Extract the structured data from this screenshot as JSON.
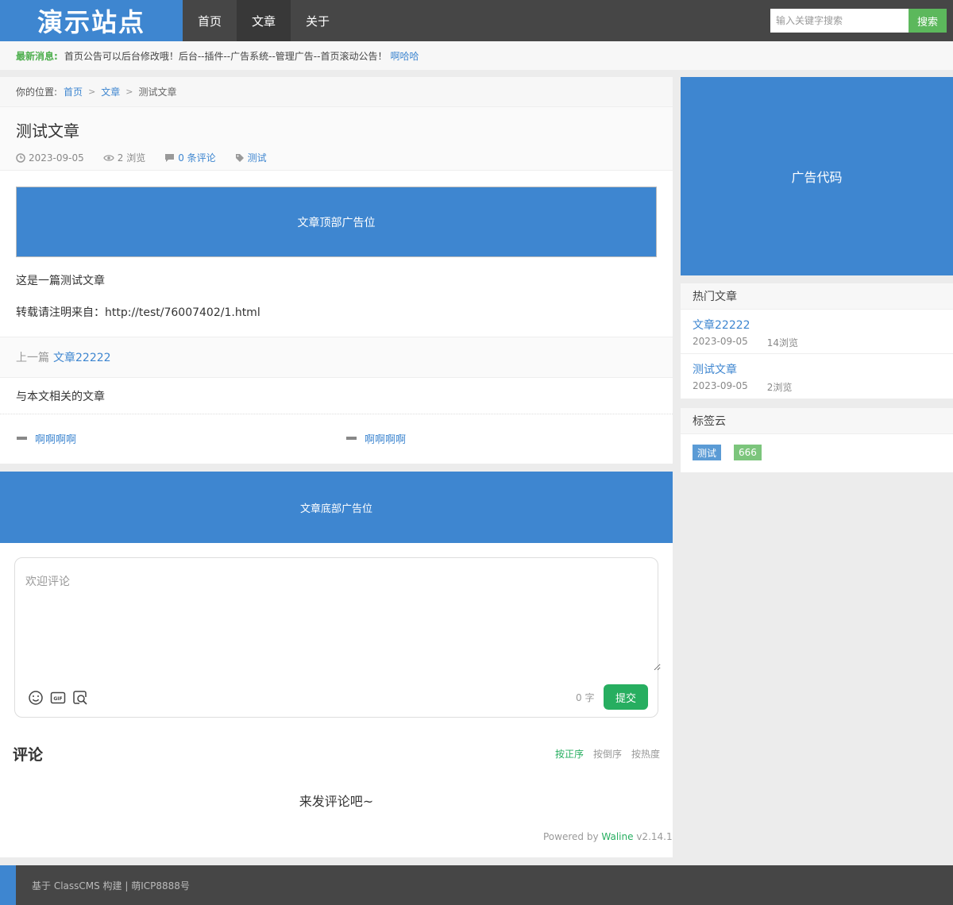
{
  "header": {
    "logo": "演示站点",
    "nav": [
      {
        "label": "首页"
      },
      {
        "label": "文章"
      },
      {
        "label": "关于"
      }
    ],
    "search_placeholder": "输入关键字搜索",
    "search_button": "搜索"
  },
  "notice": {
    "label": "最新消息:",
    "text": "首页公告可以后台修改哦！后台--插件--广告系统--管理广告--首页滚动公告！",
    "link": "啊哈哈"
  },
  "breadcrumb": {
    "prefix": "你的位置:",
    "items": [
      "首页",
      "文章"
    ],
    "current": "测试文章"
  },
  "article": {
    "title": "测试文章",
    "date": "2023-09-05",
    "views": "2 浏览",
    "comments": "0 条评论",
    "tag": "测试",
    "ad_top": "文章顶部广告位",
    "paragraphs": [
      "这是一篇测试文章",
      "转载请注明来自：http://test/76007402/1.html"
    ],
    "prev_label": "上一篇",
    "prev_link": "文章22222",
    "related_title": "与本文相关的文章",
    "related": [
      "啊啊啊啊",
      "啊啊啊啊"
    ]
  },
  "ad_bottom": "文章底部广告位",
  "comments": {
    "placeholder": "欢迎评论",
    "word_count": "0 字",
    "submit": "提交",
    "title": "评论",
    "sort": [
      "按正序",
      "按倒序",
      "按热度"
    ],
    "empty": "来发评论吧~",
    "powered_prefix": "Powered by",
    "powered_brand": "Waline",
    "powered_version": "v2.14.1"
  },
  "sidebar": {
    "ad": "广告代码",
    "hot_title": "热门文章",
    "hot": [
      {
        "title": "文章22222",
        "date": "2023-09-05",
        "views": "14浏览"
      },
      {
        "title": "测试文章",
        "date": "2023-09-05",
        "views": "2浏览"
      }
    ],
    "tags_title": "标签云",
    "tags": [
      {
        "label": "测试",
        "color": "#5b9bd5"
      },
      {
        "label": "666",
        "color": "#7cc57c"
      }
    ]
  },
  "footer": {
    "text": "基于 ClassCMS 构建 | 萌ICP8888号"
  },
  "colors": {
    "accent": "#3e86d0",
    "header_bg": "#464646",
    "green": "#5cb85c",
    "waline_green": "#27ae60"
  }
}
